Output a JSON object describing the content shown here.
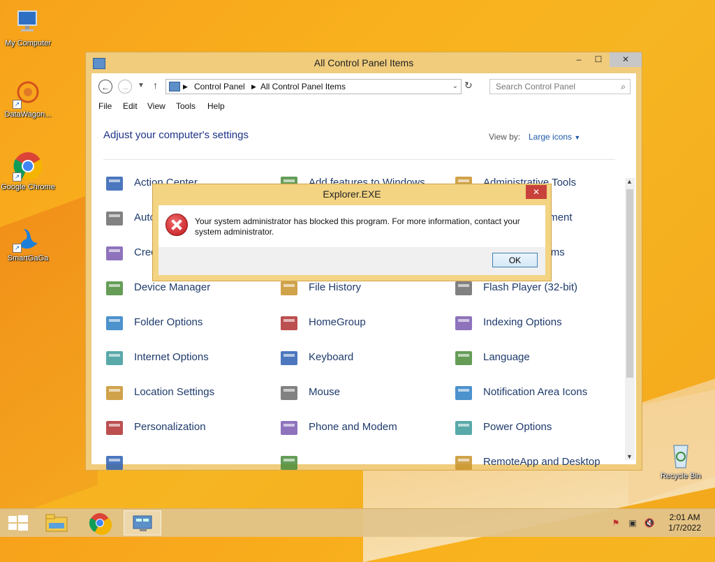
{
  "desktop": {
    "icons": [
      {
        "label": "My Computer"
      },
      {
        "label": "DataWagon..."
      },
      {
        "label": "Google Chrome"
      },
      {
        "label": "SmartGaGa"
      },
      {
        "label": "Recycle Bin"
      }
    ]
  },
  "window": {
    "title": "All Control Panel Items",
    "controls": {
      "minimize": "–",
      "maximize": "☐",
      "close": "✕"
    },
    "address": {
      "crumbs": [
        "Control Panel",
        "All Control Panel Items"
      ]
    },
    "search": {
      "placeholder": "Search Control Panel"
    },
    "menu": [
      "File",
      "Edit",
      "View",
      "Tools",
      "Help"
    ],
    "heading": "Adjust your computer's settings",
    "view_by": {
      "label": "View by:",
      "value": "Large icons"
    },
    "items": [
      {
        "label": "Action Center",
        "icon": "action-center-flag-icon"
      },
      {
        "label": "Add features to Windows",
        "icon": "add-features-icon"
      },
      {
        "label": "Administrative Tools",
        "icon": "admin-tools-icon"
      },
      {
        "label": "AutoPlay",
        "icon": "autoplay-icon"
      },
      {
        "label": "",
        "icon": "item-icon"
      },
      {
        "label": "Color Management",
        "icon": "color-management-icon"
      },
      {
        "label": "Credential Manager",
        "icon": "credential-icon"
      },
      {
        "label": "",
        "icon": "item-icon"
      },
      {
        "label": "Default Programs",
        "icon": "default-programs-icon"
      },
      {
        "label": "Device Manager",
        "icon": "device-manager-icon"
      },
      {
        "label": "File History",
        "icon": "file-history-icon"
      },
      {
        "label": "Flash Player (32-bit)",
        "icon": "flash-icon"
      },
      {
        "label": "Folder Options",
        "icon": "folder-options-icon"
      },
      {
        "label": "HomeGroup",
        "icon": "homegroup-icon"
      },
      {
        "label": "Indexing Options",
        "icon": "indexing-icon"
      },
      {
        "label": "Internet Options",
        "icon": "internet-options-icon"
      },
      {
        "label": "Keyboard",
        "icon": "keyboard-icon"
      },
      {
        "label": "Language",
        "icon": "language-icon"
      },
      {
        "label": "Location Settings",
        "icon": "location-icon"
      },
      {
        "label": "Mouse",
        "icon": "mouse-icon"
      },
      {
        "label": "Notification Area Icons",
        "icon": "notification-icon"
      },
      {
        "label": "Personalization",
        "icon": "personalization-icon"
      },
      {
        "label": "Phone and Modem",
        "icon": "phone-modem-icon"
      },
      {
        "label": "Power Options",
        "icon": "power-icon"
      },
      {
        "label": "",
        "icon": "item-icon"
      },
      {
        "label": "",
        "icon": "item-icon"
      },
      {
        "label": "RemoteApp and Desktop",
        "icon": "remoteapp-icon"
      }
    ]
  },
  "dialog": {
    "title": "Explorer.EXE",
    "close": "✕",
    "message": "Your system administrator has blocked this program. For more information, contact your system administrator.",
    "ok": "OK"
  },
  "taskbar": {
    "time": "2:01 AM",
    "date": "1/7/2022"
  }
}
